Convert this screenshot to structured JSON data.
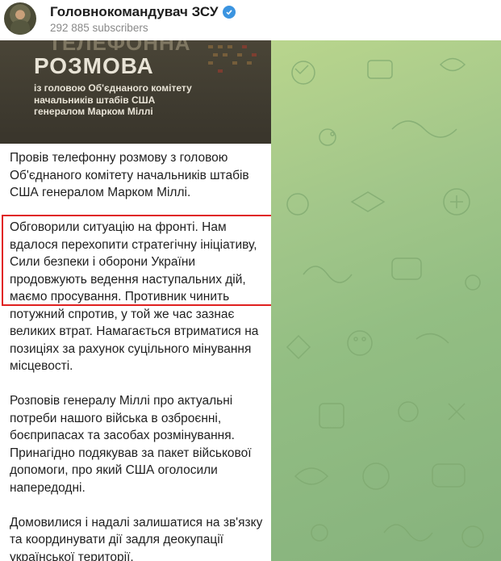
{
  "header": {
    "channel_title": "Головнокомандувач ЗСУ",
    "subscribers": "292 885 subscribers"
  },
  "post": {
    "image": {
      "top_text": "ТЕЛЕФОННА",
      "title": "РОЗМОВА",
      "subtitle_lines": [
        "із головою Об'єднаного комітету",
        "начальників штабів США",
        "генералом Марком Міллі"
      ]
    },
    "paragraphs": [
      "Провів телефонну розмову з головою Об'єднаного комітету начальників штабів США генералом Марком Міллі.",
      "Обговорили ситуацію на фронті. Нам вдалося перехопити стратегічну ініціативу, Сили безпеки і оборони України продовжують ведення наступальних дій, маємо просування. Противник чинить потужний спротив, у той же час зазнає великих втрат. Намагається втриматися на позиціях за рахунок суцільного мінування місцевості.",
      "Розповів генералу Міллі про актуальні потреби нашого війська в озброєнні, боєприпасах та засобах розмінування. Принагідно подякував за пакет військової допомоги, про який США оголосили напередодні.",
      "Домовилися і надалі залишатися на зв'язку та координувати дії задля деокупації української території."
    ]
  },
  "colors": {
    "highlight": "#e0201f",
    "verified": "#3b94e0",
    "wallpaper": "#a3c78a"
  }
}
